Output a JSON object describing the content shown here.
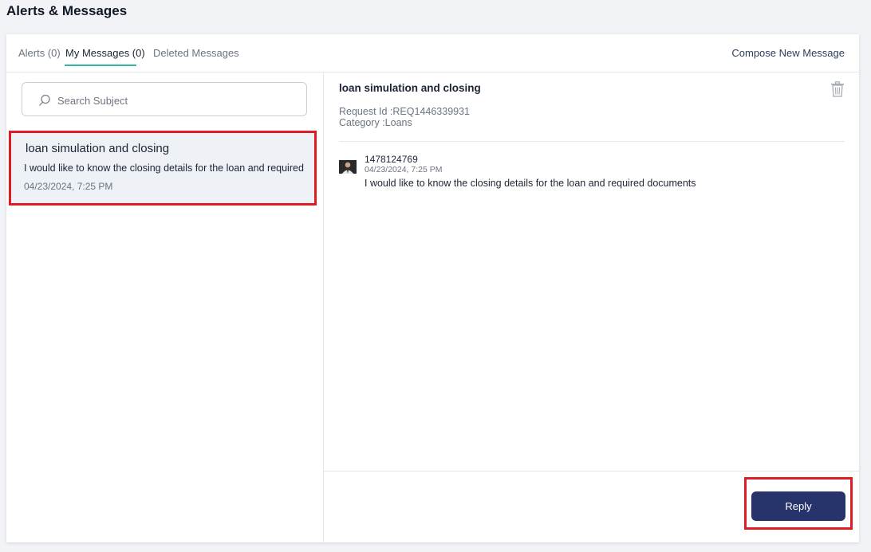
{
  "page": {
    "title": "Alerts & Messages"
  },
  "tabs": [
    {
      "label": "Alerts (0)",
      "active": false
    },
    {
      "label": "My Messages (0)",
      "active": true
    },
    {
      "label": "Deleted Messages",
      "active": false
    }
  ],
  "compose_label": "Compose New Message",
  "search": {
    "placeholder": "Search Subject",
    "value": ""
  },
  "messages": [
    {
      "subject": "loan simulation and closing",
      "preview": "I would like to know the closing details for the loan and required",
      "date": "04/23/2024, 7:25 PM",
      "selected": true
    }
  ],
  "detail": {
    "subject": "loan simulation and closing",
    "request_id": "Request Id :REQ1446339931",
    "category": "Category :Loans",
    "thread": [
      {
        "sender": "1478124769",
        "date": "04/23/2024, 7:25 PM",
        "body": "I would like to know the closing details for the loan and required documents"
      }
    ]
  },
  "footer": {
    "reply_label": "Reply"
  },
  "colors": {
    "accent_underline": "#2bb9a0",
    "reply_button": "#27336b",
    "highlight": "#e21b23",
    "selected_row": "#eef1f5"
  },
  "icons": {
    "search": "search-icon",
    "trash": "trash-icon",
    "avatar": "avatar"
  }
}
